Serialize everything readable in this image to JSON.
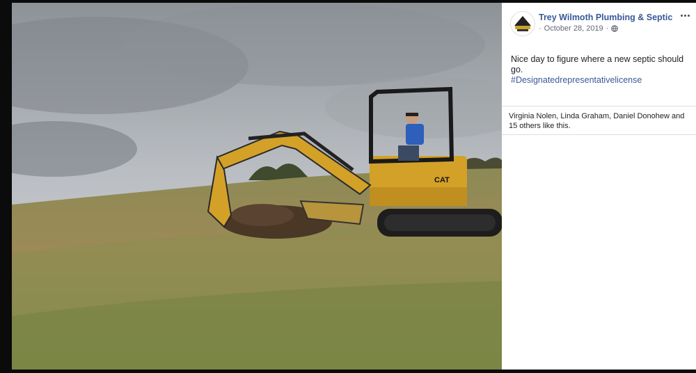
{
  "post": {
    "page_name": "Trey Wilmoth Plumbing & Septic",
    "date": "October 28, 2019",
    "separator_leading": "·",
    "separator_trailing": "·",
    "privacy_icon": "globe-icon",
    "text": "Nice day to figure where a new septic should go.",
    "hashtag": "#Designatedrepresentativelicense",
    "likes_text": "Virginia Nolen, Linda Graham, Daniel Donohew and 15 others like this."
  },
  "photo": {
    "description_icon": "excavator-photo",
    "machine_label": "CAT"
  },
  "colors": {
    "link": "#385898",
    "meta": "#616770",
    "text": "#1c1e21",
    "background": "#0b0b0b"
  }
}
